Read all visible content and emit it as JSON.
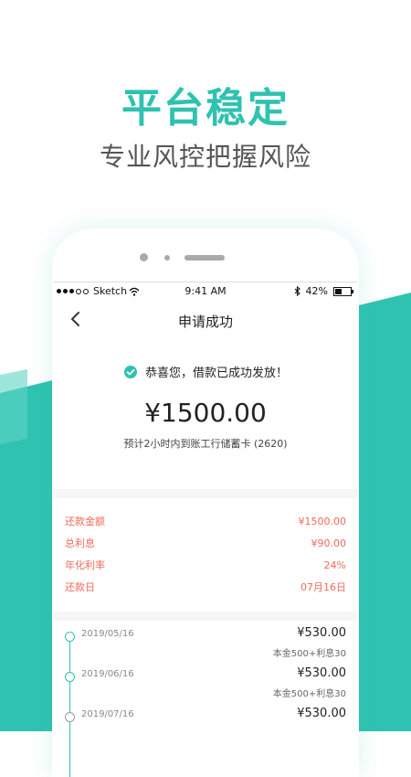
{
  "promo": {
    "headline": "平台稳定",
    "subline": "专业风控把握风险"
  },
  "colors": {
    "accent": "#2fc2b0",
    "warning_text": "#f06a5a"
  },
  "statusbar": {
    "carrier": "Sketch",
    "time": "9:41 AM",
    "battery": "42%",
    "icons": [
      "signal-dots-icon",
      "wifi-icon",
      "bluetooth-icon",
      "battery-icon"
    ]
  },
  "nav": {
    "title": "申请成功",
    "back_icon": "chevron-left-icon"
  },
  "success": {
    "message": "恭喜您，借款已成功发放！",
    "amount": "¥1500.00",
    "arrival_note": "预计2小时内到账工行储蓄卡 (2620)"
  },
  "details": [
    {
      "label": "还款金额",
      "value": "¥1500.00"
    },
    {
      "label": "总利息",
      "value": "¥90.00"
    },
    {
      "label": "年化利率",
      "value": "24%"
    },
    {
      "label": "还款日",
      "value": "07月16日"
    }
  ],
  "schedule": [
    {
      "date": "2019/05/16",
      "amount": "¥530.00",
      "detail": "本金500+利息30"
    },
    {
      "date": "2019/06/16",
      "amount": "¥530.00",
      "detail": "本金500+利息30"
    },
    {
      "date": "2019/07/16",
      "amount": "¥530.00",
      "detail": ""
    }
  ]
}
